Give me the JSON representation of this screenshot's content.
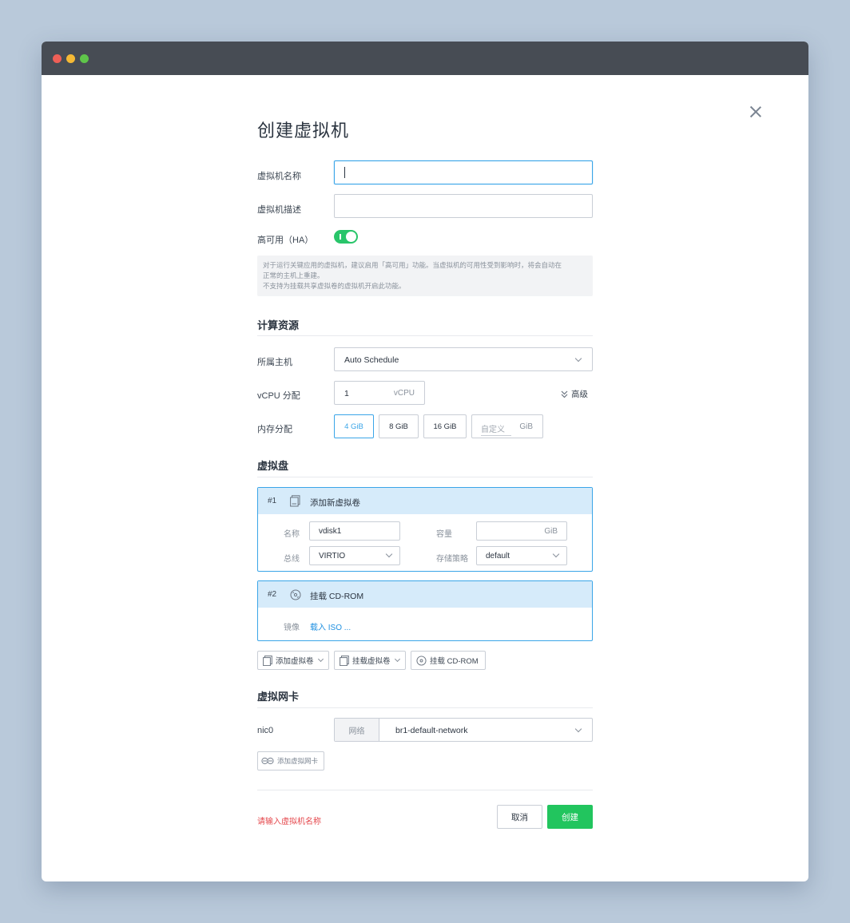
{
  "window": {
    "dots": [
      "#ee5f57",
      "#f5b935",
      "#5fc54a"
    ]
  },
  "dialog": {
    "title": "创建虚拟机",
    "name_label": "虚拟机名称",
    "name_value": "",
    "desc_label": "虚拟机描述",
    "desc_value": "",
    "ha_label": "高可用（HA）",
    "ha_enabled": true,
    "ha_note_line1": "对于运行关键应用的虚拟机，建议启用「高可用」功能。当虚拟机的可用性受到影响时，将会自动在",
    "ha_note_line2": "正常的主机上重建。",
    "ha_note_line3": "不支持为挂载共享虚拟卷的虚拟机开启此功能。"
  },
  "compute": {
    "section_title": "计算资源",
    "host_label": "所属主机",
    "host_value": "Auto Schedule",
    "vcpu_label": "vCPU 分配",
    "vcpu_value": "1",
    "vcpu_unit": "vCPU",
    "advanced_label": "高级",
    "memory_label": "内存分配",
    "memory_options": [
      "4 GiB",
      "8 GiB",
      "16 GiB"
    ],
    "memory_selected": "4 GiB",
    "custom_placeholder": "自定义",
    "custom_unit": "GiB"
  },
  "disks": {
    "section_title": "虚拟盘",
    "disk1": {
      "index": "#1",
      "header": "添加新虚拟卷",
      "name_label": "名称",
      "name_value": "vdisk1",
      "capacity_label": "容量",
      "capacity_unit": "GiB",
      "bus_label": "总线",
      "bus_value": "VIRTIO",
      "policy_label": "存储策略",
      "policy_value": "default"
    },
    "disk2": {
      "index": "#2",
      "header": "挂载 CD-ROM",
      "image_label": "镜像",
      "image_link": "载入 ISO ..."
    },
    "add_volume": "添加虚拟卷",
    "mount_volume": "挂载虚拟卷",
    "mount_cdrom": "挂载 CD-ROM"
  },
  "nics": {
    "section_title": "虚拟网卡",
    "nic_label": "nic0",
    "network_label": "网络",
    "network_value": "br1-default-network",
    "add_nic": "添加虚拟网卡"
  },
  "footer": {
    "error": "请输入虚拟机名称",
    "cancel": "取消",
    "create": "创建"
  }
}
